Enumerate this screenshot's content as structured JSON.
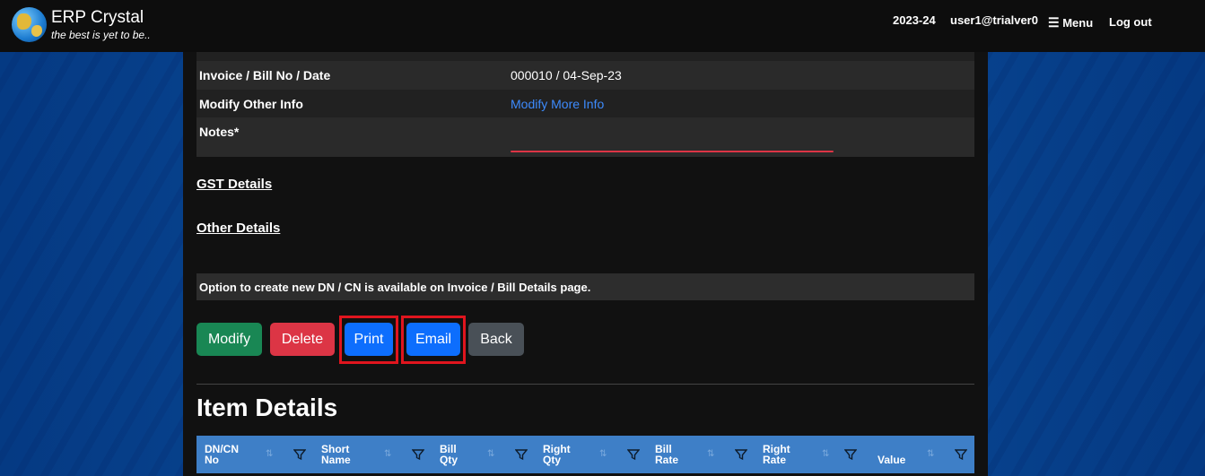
{
  "header": {
    "brand_title": "ERP Crystal",
    "brand_tagline": "the best is yet to be..",
    "fiscal_year": "2023-24",
    "user": "user1@trialver0",
    "menu_icon": "☰",
    "menu_label": "Menu",
    "logout_label": "Log out"
  },
  "details": {
    "invoice_label": "Invoice / Bill No / Date",
    "invoice_value": "000010 / 04-Sep-23",
    "modify_label": "Modify Other Info",
    "modify_link": "Modify More Info",
    "notes_label": "Notes*"
  },
  "sections": {
    "gst": "GST Details",
    "other": "Other Details"
  },
  "option_note": "Option to create new DN / CN is available on Invoice / Bill Details page.",
  "buttons": {
    "modify": "Modify",
    "delete": "Delete",
    "print": "Print",
    "email": "Email",
    "back": "Back"
  },
  "item_details_title": "Item Details",
  "table": {
    "columns": [
      "DN/CN\nNo",
      "Short\nName",
      "Bill\nQty",
      "Right\nQty",
      "Bill\nRate",
      "Right\nRate",
      "Value"
    ]
  },
  "colors": {
    "navbar": "#0d0d0d",
    "highlight": "#e0151e",
    "table_header": "#3e7fc7",
    "link": "#3d8bfd"
  }
}
